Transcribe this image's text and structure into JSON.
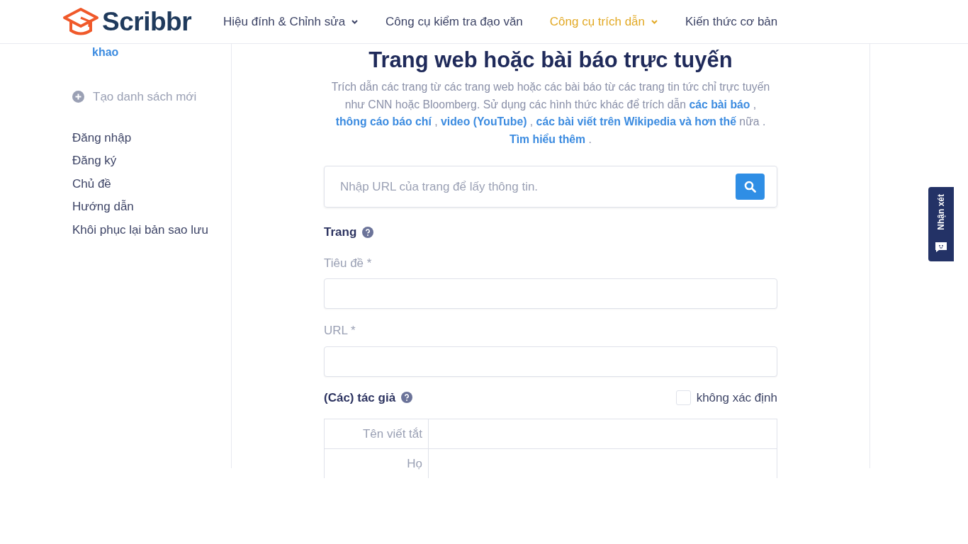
{
  "header": {
    "logo": "Scribbr",
    "nav": [
      {
        "label": "Hiệu đính & Chỉnh sửa",
        "dropdown": true,
        "selected": false
      },
      {
        "label": "Công cụ kiểm tra đạo văn",
        "dropdown": false,
        "selected": false
      },
      {
        "label": "Công cụ trích dẫn",
        "dropdown": true,
        "selected": true
      },
      {
        "label": "Kiến thức cơ bản",
        "dropdown": false,
        "selected": false
      }
    ]
  },
  "sidebar": {
    "cut_link": "khao",
    "new_list": "Tạo danh sách mới",
    "items": [
      "Đăng nhập",
      "Đăng ký",
      "Chủ đề",
      "Hướng dẫn",
      "Khôi phục lại bản sao lưu"
    ]
  },
  "main": {
    "title": "Trang web hoặc bài báo trực tuyến",
    "description": [
      {
        "kind": "text",
        "text": "Trích dẫn các trang từ các trang web hoặc các bài báo từ các trang tin tức chỉ trực tuyến như CNN hoặc Bloomberg. Sử dụng các hình thức khác để trích dẫn "
      },
      {
        "kind": "link",
        "text": "các bài báo"
      },
      {
        "kind": "text",
        "text": " , "
      },
      {
        "kind": "link",
        "text": "thông cáo báo chí"
      },
      {
        "kind": "text",
        "text": " , "
      },
      {
        "kind": "link",
        "text": "video (YouTube)"
      },
      {
        "kind": "text",
        "text": " , "
      },
      {
        "kind": "link",
        "text": "các bài viết trên Wikipedia và hơn thế"
      },
      {
        "kind": "text",
        "text": " nữa . "
      },
      {
        "kind": "link",
        "text": "Tìm hiểu thêm"
      },
      {
        "kind": "text",
        "text": " ."
      }
    ],
    "url_search": {
      "placeholder": "Nhập URL của trang để lấy thông tin."
    },
    "section": "Trang",
    "fields": [
      {
        "label": "Tiêu đề *"
      },
      {
        "label": "URL *"
      }
    ],
    "authors": {
      "label": "(Các) tác giả",
      "unknown_label": "không xác định",
      "unknown_checked": false,
      "rows": [
        "Tên viết tắt",
        "Họ"
      ]
    }
  },
  "feedback_tab": "Nhận xét"
}
